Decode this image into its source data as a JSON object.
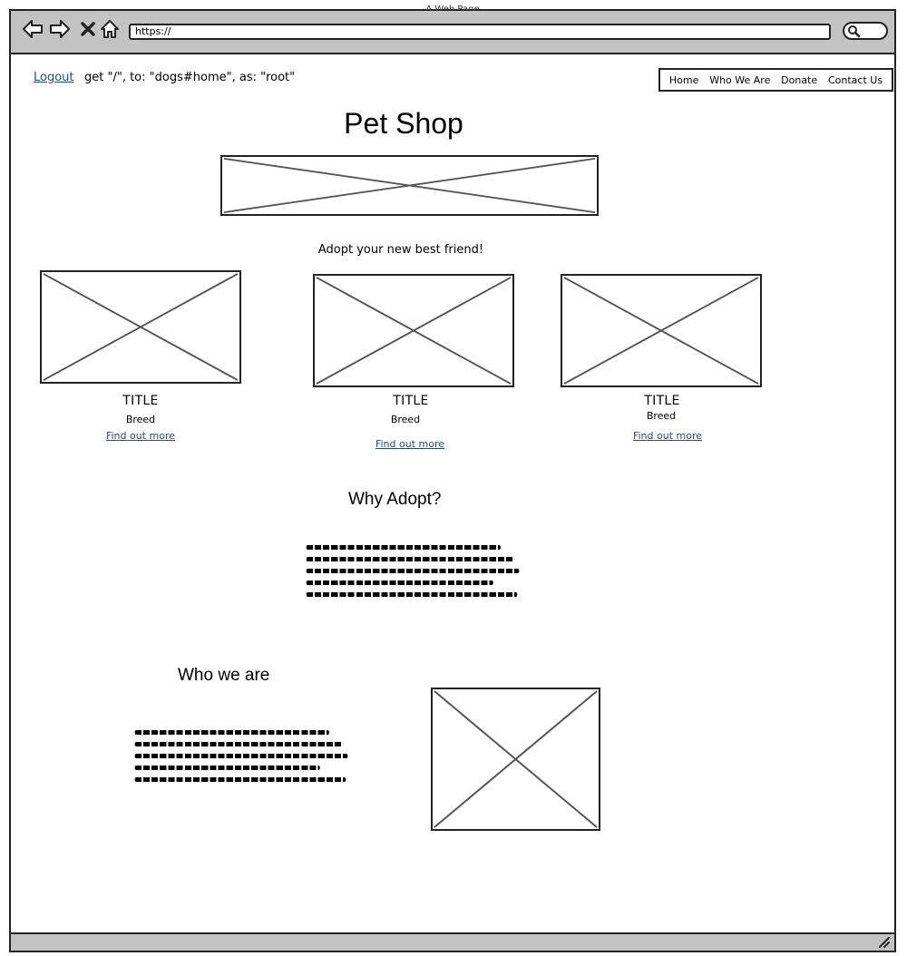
{
  "window": {
    "title": "A Web Page",
    "address": "https://"
  },
  "header": {
    "logout_label": "Logout",
    "route_text": "get \"/\", to: \"dogs#home\", as: \"root\""
  },
  "nav": {
    "items": [
      {
        "label": "Home"
      },
      {
        "label": "Who We Are"
      },
      {
        "label": "Donate"
      },
      {
        "label": "Contact Us"
      }
    ]
  },
  "main": {
    "title": "Pet Shop",
    "tagline": "Adopt your new best friend!",
    "cards": [
      {
        "title": "TITLE",
        "breed": "Breed",
        "link": "Find out more"
      },
      {
        "title": "TITLE",
        "breed": "Breed",
        "link": "Find out more"
      },
      {
        "title": "TITLE",
        "breed": "Breed",
        "link": "Find out more"
      }
    ],
    "why_adopt": {
      "title": "Why Adopt?"
    },
    "who_we_are": {
      "title": "Who we are"
    }
  },
  "icons": {
    "back": "back-arrow-icon",
    "forward": "forward-arrow-icon",
    "stop": "close-icon",
    "home": "home-icon",
    "search": "search-icon"
  }
}
